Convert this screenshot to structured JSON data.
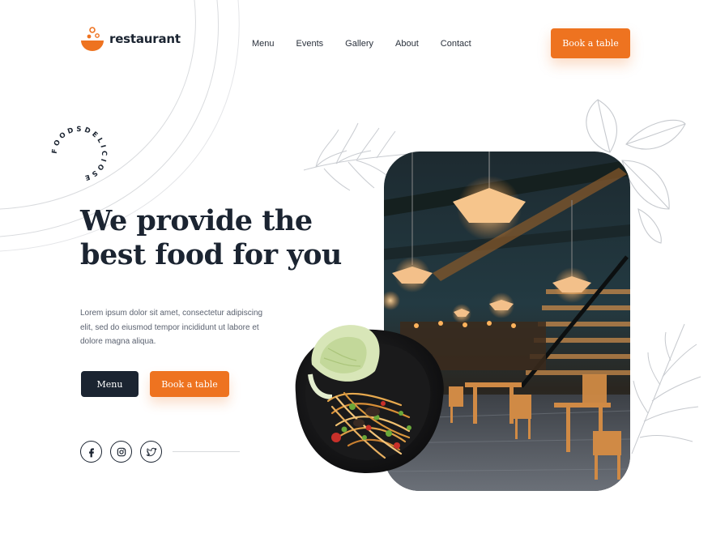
{
  "brand": {
    "name": "restaurant",
    "accent": "#ee7320",
    "dark": "#1b2431"
  },
  "nav": {
    "items": [
      "Menu",
      "Events",
      "Gallery",
      "About",
      "Contact"
    ]
  },
  "header": {
    "cta": "Book a table"
  },
  "badge": {
    "circle_text": "FOODSDELICIOSE"
  },
  "hero": {
    "title_line1": "We provide the",
    "title_line2": "best food for you",
    "description": "Lorem ipsum dolor sit amet, consectetur adipiscing elit, sed do eiusmod tempor incididunt ut labore et dolore magna aliqua.",
    "menu_button": "Menu",
    "book_button": "Book a table"
  },
  "socials": {
    "icons": [
      "facebook-icon",
      "instagram-icon",
      "twitter-icon"
    ]
  }
}
